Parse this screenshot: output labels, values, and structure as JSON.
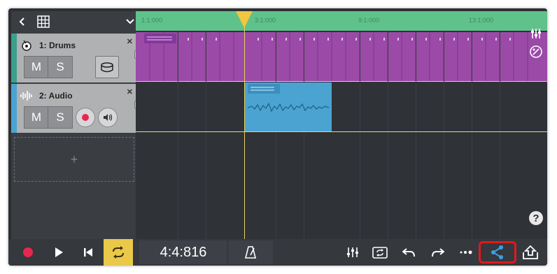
{
  "header": {
    "back_icon": "chevron-left-icon",
    "grid_icon": "grid-icon",
    "dropdown_icon": "chevron-down-icon"
  },
  "tracks": [
    {
      "label": "1: Drums",
      "mute_label": "M",
      "solo_label": "S",
      "color": "#9b4aa8",
      "stripe_color": "#3aa08c",
      "icon": "drums-icon",
      "instrument_icon": "drum-kit-icon"
    },
    {
      "label": "2: Audio",
      "mute_label": "M",
      "solo_label": "S",
      "color": "#4aa3d1",
      "stripe_color": "#4aa3d1",
      "icon": "audio-wave-icon",
      "record_icon": "record-arm-icon",
      "monitor_icon": "speaker-icon"
    }
  ],
  "add_track": {
    "label": "+"
  },
  "ruler": {
    "labels": [
      "1:1:000",
      "3:1:000",
      "9:1:000",
      "13:1:000"
    ],
    "color": "#5fc28a"
  },
  "side_icons": {
    "mixer": "mixer-icon",
    "instrument": "piano-icon",
    "help": "?"
  },
  "transport": {
    "record_icon": "record-icon",
    "play_icon": "play-icon",
    "rewind_icon": "skip-back-icon",
    "loop_icon": "loop-icon",
    "time": "4:4:816",
    "metronome_icon": "metronome-icon",
    "mixer_icon": "sliders-icon",
    "sync_icon": "sync-icon",
    "undo_icon": "undo-icon",
    "redo_icon": "redo-icon",
    "more_icon": "more-icon",
    "share_icon": "share-icon",
    "export_icon": "export-icon"
  },
  "colors": {
    "background": "#2c2f33",
    "accent_yellow": "#e9c84a",
    "share_blue": "#3ba0e6",
    "record_red": "#e8274f",
    "highlight_red": "#e0191d"
  }
}
